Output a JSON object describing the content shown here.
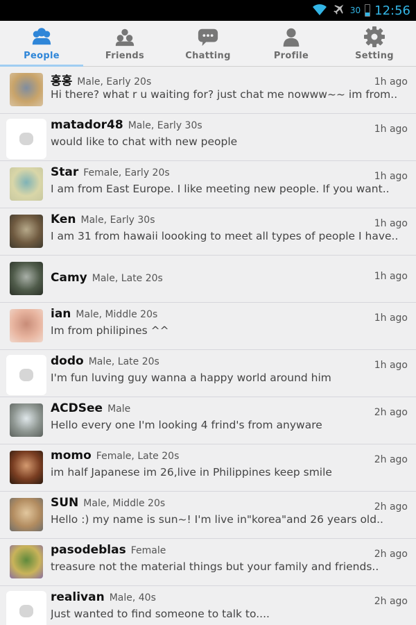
{
  "status": {
    "battery_pct": "30",
    "time": "12:56"
  },
  "tabs": [
    {
      "label": "People",
      "icon": "people-icon",
      "active": true
    },
    {
      "label": "Friends",
      "icon": "friends-icon",
      "active": false
    },
    {
      "label": "Chatting",
      "icon": "chat-bubble-icon",
      "active": false
    },
    {
      "label": "Profile",
      "icon": "profile-icon",
      "active": false
    },
    {
      "label": "Setting",
      "icon": "gear-icon",
      "active": false
    }
  ],
  "people": [
    {
      "name": "홍홍",
      "meta": "Male, Early 20s",
      "time": "1h ago",
      "message": "Hi there? what r u waiting for? just chat me nowww~~ im from..",
      "avatar_colors": [
        "#c9a46a",
        "#7f8da0",
        "#d8c2a0"
      ]
    },
    {
      "name": "matador48",
      "meta": "Male, Early 30s",
      "time": "1h ago",
      "message": "would like to chat with new people",
      "avatar_colors": []
    },
    {
      "name": "Star",
      "meta": "Female, Early 20s",
      "time": "1h ago",
      "message": "I am from East Europe. I like meeting new people. If you want..",
      "avatar_colors": [
        "#d9d6a8",
        "#7fb3b7",
        "#c8c8a0"
      ]
    },
    {
      "name": "Ken",
      "meta": "Male, Early 30s",
      "time": "1h ago",
      "message": "I am 31 from hawaii loooking to meet all types of people I have..",
      "avatar_colors": [
        "#6f5a40",
        "#b6a98a",
        "#3f3a2e"
      ]
    },
    {
      "name": "Camy",
      "meta": "Male, Late 20s",
      "time": "1h ago",
      "message": "",
      "avatar_colors": [
        "#4f5b4a",
        "#a9b0a8",
        "#2b3128"
      ]
    },
    {
      "name": "ian",
      "meta": "Male, Middle 20s",
      "time": "1h ago",
      "message": "Im from philipines ^^",
      "avatar_colors": [
        "#e8b5a0",
        "#c88c78",
        "#f0d8cc"
      ]
    },
    {
      "name": "dodo",
      "meta": "Male, Late 20s",
      "time": "1h ago",
      "message": "I'm fun luving guy wanna a happy world around him",
      "avatar_colors": []
    },
    {
      "name": "ACDSee",
      "meta": "Male",
      "time": "2h ago",
      "message": "Hello every one I'm looking 4 frind's from anyware",
      "avatar_colors": [
        "#8d9590",
        "#dfe7ea",
        "#5c625e"
      ]
    },
    {
      "name": "momo",
      "meta": "Female, Late 20s",
      "time": "2h ago",
      "message": "im half Japanese im 26,live in Philippines keep smile",
      "avatar_colors": [
        "#7a3e22",
        "#d49a70",
        "#2c1b10"
      ]
    },
    {
      "name": "SUN",
      "meta": "Male, Middle 20s",
      "time": "2h ago",
      "message": "Hello :) my name is sun~! I'm live in\"korea\"and 26 years old..",
      "avatar_colors": [
        "#b28c60",
        "#e2c79e",
        "#6f6e6a"
      ]
    },
    {
      "name": "pasodeblas",
      "meta": "Female",
      "time": "2h ago",
      "message": "treasure not the material things but your family and friends..",
      "avatar_colors": [
        "#c9b35a",
        "#5f8a3c",
        "#8a6fa0"
      ]
    },
    {
      "name": "realivan",
      "meta": "Male, 40s",
      "time": "2h ago",
      "message": "Just wanted to find someone to talk to....",
      "avatar_colors": []
    }
  ],
  "colors": {
    "accent": "#2f86d8",
    "status_accent": "#33b5e5"
  }
}
